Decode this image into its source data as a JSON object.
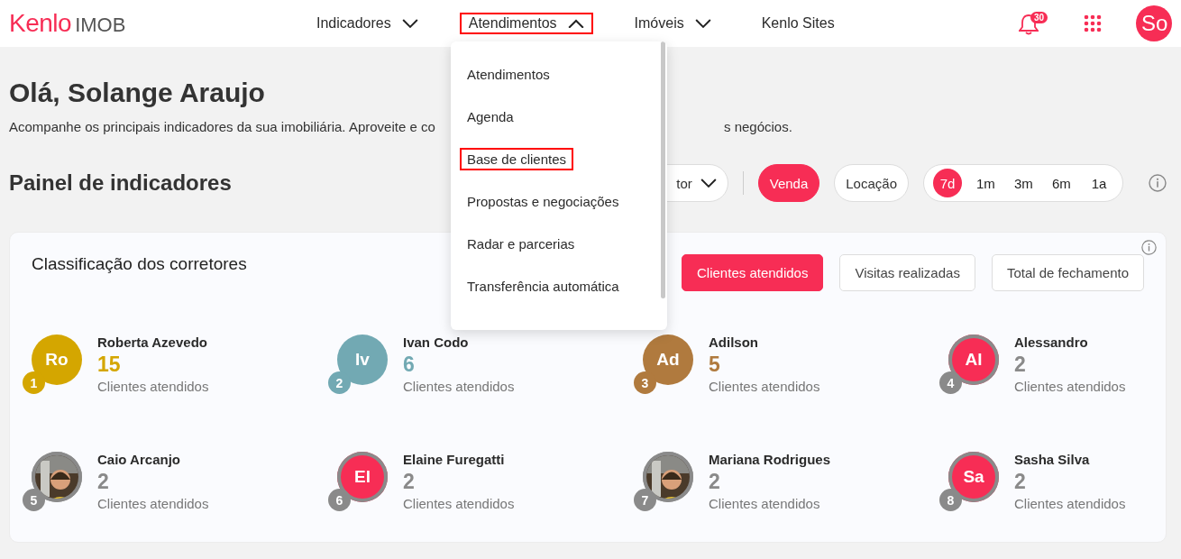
{
  "logo": {
    "brand": "Kenlo",
    "product": "IMOB"
  },
  "nav": [
    {
      "label": "Indicadores",
      "expanded": false,
      "highlighted": false
    },
    {
      "label": "Atendimentos",
      "expanded": true,
      "highlighted": true
    },
    {
      "label": "Imóveis",
      "expanded": false,
      "highlighted": false
    },
    {
      "label": "Kenlo Sites",
      "kind": "link"
    }
  ],
  "notifications": {
    "count": "30"
  },
  "user": {
    "initials": "So"
  },
  "dropdown": {
    "items": [
      {
        "label": "Atendimentos",
        "highlighted": false
      },
      {
        "label": "Agenda",
        "highlighted": false
      },
      {
        "label": "Base de clientes",
        "highlighted": true
      },
      {
        "label": "Propostas e negociações",
        "highlighted": false
      },
      {
        "label": "Radar e parcerias",
        "highlighted": false
      },
      {
        "label": "Transferência automática",
        "highlighted": false
      }
    ]
  },
  "greeting": {
    "title": "Olá, Solange Araujo",
    "subtitle_start": "Acompanhe os principais indicadores da sua imobiliária. Aproveite e co",
    "subtitle_end": "s negócios."
  },
  "panel": {
    "title": "Painel de indicadores",
    "filter": "tor",
    "business": [
      {
        "label": "Venda",
        "selected": true
      },
      {
        "label": "Locação",
        "selected": false
      }
    ],
    "periods": [
      {
        "label": "7d",
        "selected": true
      },
      {
        "label": "1m",
        "selected": false
      },
      {
        "label": "3m",
        "selected": false
      },
      {
        "label": "6m",
        "selected": false
      },
      {
        "label": "1a",
        "selected": false
      }
    ]
  },
  "ranking": {
    "title": "Classificação dos corretores",
    "tabs": [
      {
        "label": "Clientes atendidos",
        "selected": true
      },
      {
        "label": "Visitas realizadas",
        "selected": false
      },
      {
        "label": "Total de fechamento",
        "selected": false
      }
    ],
    "people": [
      {
        "rank": "1",
        "name": "Roberta Azevedo",
        "value": "15",
        "label": "Clientes atendidos",
        "kind": "initials",
        "initials": "Ro",
        "color": "#d4a600",
        "ringed": false
      },
      {
        "rank": "2",
        "name": "Ivan Codo",
        "value": "6",
        "label": "Clientes atendidos",
        "kind": "initials",
        "initials": "Iv",
        "color": "#72a9b3",
        "ringed": false
      },
      {
        "rank": "3",
        "name": "Adilson",
        "value": "5",
        "label": "Clientes atendidos",
        "kind": "initials",
        "initials": "Ad",
        "color": "#b07a3e",
        "ringed": false
      },
      {
        "rank": "4",
        "name": "Alessandro",
        "value": "2",
        "label": "Clientes atendidos",
        "kind": "initials",
        "initials": "Al",
        "color": "#f72d55",
        "ringed": true
      },
      {
        "rank": "5",
        "name": "Caio Arcanjo",
        "value": "2",
        "label": "Clientes atendidos",
        "kind": "picture",
        "ringed": true
      },
      {
        "rank": "6",
        "name": "Elaine Furegatti",
        "value": "2",
        "label": "Clientes atendidos",
        "kind": "initials",
        "initials": "El",
        "color": "#f72d55",
        "ringed": true
      },
      {
        "rank": "7",
        "name": "Mariana Rodrigues",
        "value": "2",
        "label": "Clientes atendidos",
        "kind": "picture",
        "ringed": true
      },
      {
        "rank": "8",
        "name": "Sasha Silva",
        "value": "2",
        "label": "Clientes atendidos",
        "kind": "initials",
        "initials": "Sa",
        "color": "#f72d55",
        "ringed": true
      }
    ]
  }
}
